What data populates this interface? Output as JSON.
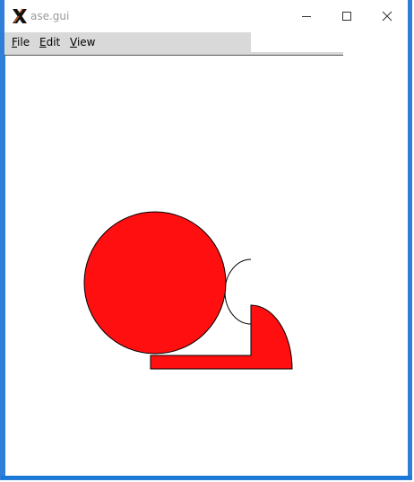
{
  "window": {
    "title": "ase.gui",
    "icon": "x-logo-icon",
    "border_color": "#2f7fd8"
  },
  "menubar": {
    "items": [
      {
        "label_underline": "F",
        "label_rest": "ile"
      },
      {
        "label_underline": "E",
        "label_rest": "dit"
      },
      {
        "label_underline": "V",
        "label_rest": "iew"
      }
    ]
  },
  "canvas": {
    "atom_fill": "#ff0f0f",
    "outline": "#000000"
  }
}
